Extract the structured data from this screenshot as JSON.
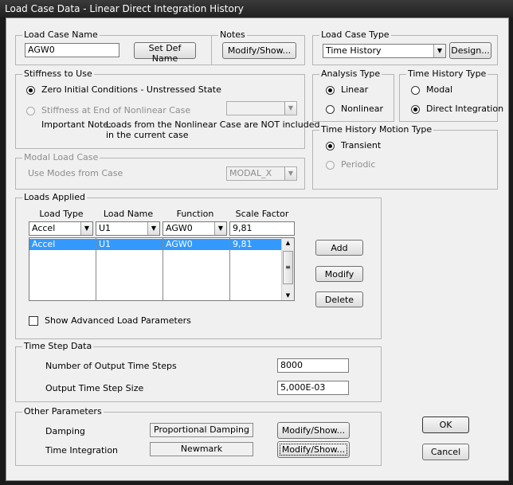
{
  "window": {
    "title": "Load Case Data - Linear Direct Integration History"
  },
  "load_case_name": {
    "legend": "Load Case Name",
    "value": "AGW0",
    "set_def_name_label": "Set Def Name"
  },
  "notes": {
    "legend": "Notes",
    "button_label": "Modify/Show..."
  },
  "load_case_type": {
    "legend": "Load Case Type",
    "selected": "Time History",
    "design_label": "Design..."
  },
  "stiffness": {
    "legend": "Stiffness to Use",
    "zero_label": "Zero Initial Conditions - Unstressed State",
    "nonlinear_label": "Stiffness at End of Nonlinear Case",
    "nonlinear_case_value": "",
    "note_label": "Important Note:",
    "note_line1": "Loads from the Nonlinear Case are NOT included",
    "note_line2": "in the current case"
  },
  "analysis_type": {
    "legend": "Analysis Type",
    "linear_label": "Linear",
    "nonlinear_label": "Nonlinear"
  },
  "time_history_type": {
    "legend": "Time History Type",
    "modal_label": "Modal",
    "direct_label": "Direct Integration"
  },
  "motion_type": {
    "legend": "Time History Motion Type",
    "transient_label": "Transient",
    "periodic_label": "Periodic"
  },
  "modal_load_case": {
    "legend": "Modal Load Case",
    "use_modes_label": "Use Modes from Case",
    "selected": "MODAL_X"
  },
  "loads_applied": {
    "legend": "Loads Applied",
    "columns": [
      "Load Type",
      "Load Name",
      "Function",
      "Scale Factor"
    ],
    "edit_row": [
      "Accel",
      "U1",
      "AGW0",
      "9,81"
    ],
    "rows": [
      [
        "Accel",
        "U1",
        "AGW0",
        "9,81"
      ]
    ],
    "add_label": "Add",
    "modify_label": "Modify",
    "delete_label": "Delete",
    "show_advanced_label": "Show Advanced Load Parameters"
  },
  "time_step": {
    "legend": "Time Step Data",
    "num_steps_label": "Number of Output Time Steps",
    "num_steps_value": "8000",
    "step_size_label": "Output Time Step Size",
    "step_size_value": "5,000E-03"
  },
  "other_params": {
    "legend": "Other Parameters",
    "damping_label": "Damping",
    "damping_value": "Proportional Damping",
    "integration_label": "Time Integration",
    "integration_value": "Newmark",
    "modify_label": "Modify/Show..."
  },
  "actions": {
    "ok_label": "OK",
    "cancel_label": "Cancel"
  }
}
